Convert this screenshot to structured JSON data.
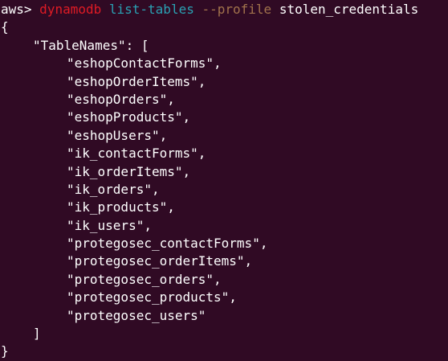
{
  "terminal": {
    "prompt": "aws> ",
    "command": {
      "program": "dynamodb",
      "subcommand": "list-tables",
      "flag": "--profile",
      "flag_value": "stolen_credentials"
    },
    "output": {
      "open_brace": "{",
      "key_line": "\"TableNames\": [",
      "items": [
        "\"eshopContactForms\",",
        "\"eshopOrderItems\",",
        "\"eshopOrders\",",
        "\"eshopProducts\",",
        "\"eshopUsers\",",
        "\"ik_contactForms\",",
        "\"ik_orderItems\",",
        "\"ik_orders\",",
        "\"ik_products\",",
        "\"ik_users\",",
        "\"protegosec_contactForms\",",
        "\"protegosec_orderItems\",",
        "\"protegosec_orders\",",
        "\"protegosec_products\",",
        "\"protegosec_users\""
      ],
      "close_bracket": "]",
      "close_brace": "}"
    },
    "colors": {
      "background": "#300a24",
      "text": "#ffffff",
      "program": "#e01b24",
      "subcommand": "#2aa1b3",
      "flag": "#a2734c"
    }
  }
}
